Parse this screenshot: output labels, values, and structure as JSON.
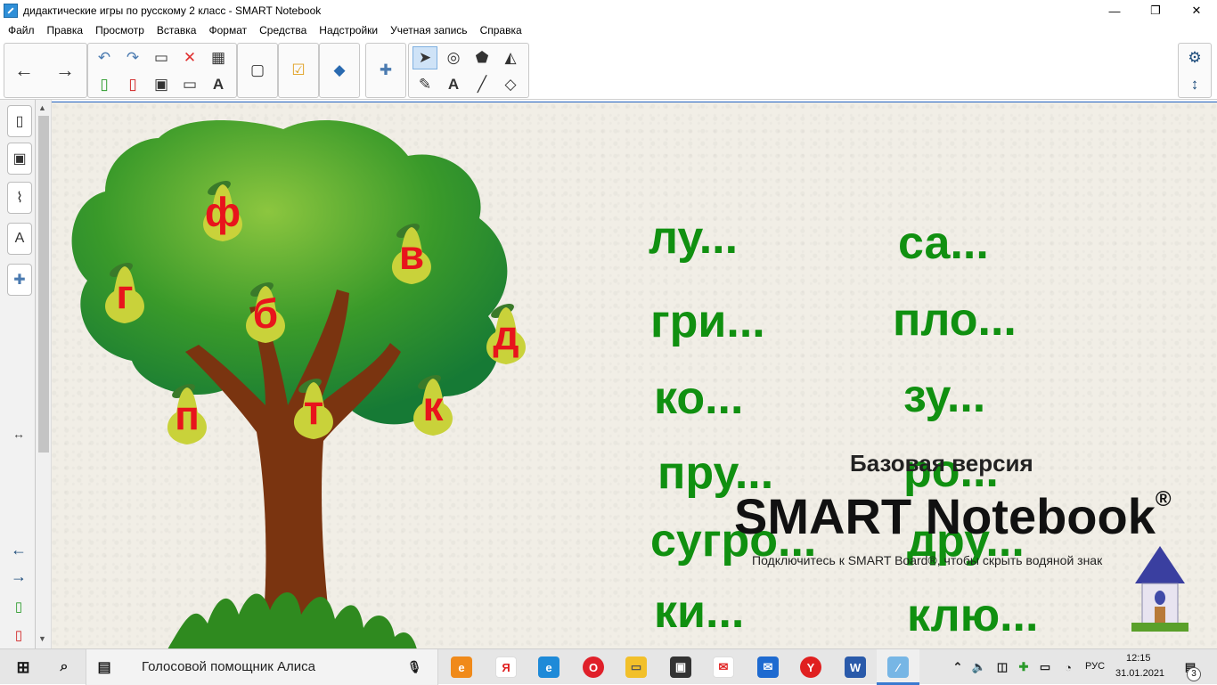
{
  "window": {
    "title": "дидактические игры по русскому 2 класс - SMART Notebook",
    "minimize": "—",
    "maximize": "❐",
    "close": "✕"
  },
  "menu": [
    "Файл",
    "Правка",
    "Просмотр",
    "Вставка",
    "Формат",
    "Средства",
    "Надстройки",
    "Учетная запись",
    "Справка"
  ],
  "pears": [
    "ф",
    "в",
    "г",
    "б",
    "д",
    "п",
    "т",
    "к"
  ],
  "words_left": [
    "лу...",
    "гри...",
    "ко...",
    "пру...",
    "сугро...",
    "ки..."
  ],
  "words_right": [
    "са...",
    "пло...",
    "зу...",
    "ро...",
    "дру...",
    "клю..."
  ],
  "watermark": {
    "subtitle": "Базовая версия",
    "product": "SMART Notebook",
    "registered": "®",
    "note": "Подключитесь к SMART Board®, чтобы скрыть водяной знак"
  },
  "taskbar": {
    "search_text": "Голосовой помощник Алиса",
    "language": "РУС",
    "time": "12:15",
    "date": "31.01.2021",
    "notifications": "3"
  },
  "colors": {
    "pear_letter": "#e8141c",
    "word_text": "#109010",
    "canvas_bg": "#f1eee6"
  }
}
